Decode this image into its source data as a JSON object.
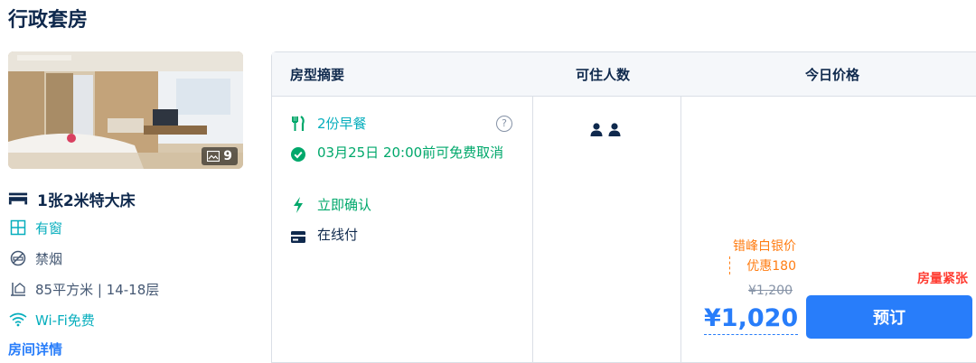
{
  "room": {
    "title": "行政套房",
    "photo_count": "9",
    "bed": "1张2米特大床",
    "window": "有窗",
    "smoking": "禁烟",
    "area_floor": "85平方米 | 14-18层",
    "wifi": "Wi-Fi免费",
    "details_link": "房间详情"
  },
  "table": {
    "headers": {
      "summary": "房型摘要",
      "guests": "可住人数",
      "price": "今日价格"
    },
    "perks": {
      "breakfast": "2份早餐",
      "cancel": "03月25日 20:00前可免费取消",
      "confirm": "立即确认",
      "payment": "在线付"
    },
    "help_symbol": "?",
    "guest_count": 2,
    "price": {
      "promo_name": "错峰白银价",
      "promo_discount": "优惠180",
      "original": "¥1,200",
      "final": "¥1,020",
      "scarcity": "房量紧张",
      "book_label": "预订"
    }
  },
  "colors": {
    "accent": "#287dfa",
    "teal": "#06aebd",
    "green": "#00a86b",
    "orange": "#ff7d13",
    "red": "#ff3b30"
  }
}
